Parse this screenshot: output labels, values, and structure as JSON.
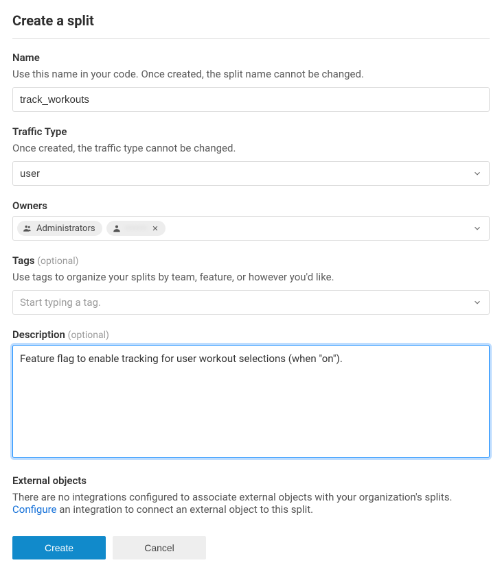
{
  "title": "Create a split",
  "name": {
    "label": "Name",
    "hint": "Use this name in your code. Once created, the split name cannot be changed.",
    "value": "track_workouts"
  },
  "trafficType": {
    "label": "Traffic Type",
    "hint": "Once created, the traffic type cannot be changed.",
    "value": "user"
  },
  "owners": {
    "label": "Owners",
    "chips": [
      {
        "label": "Administrators",
        "icon": "group",
        "removable": false
      },
      {
        "label": "······",
        "icon": "person",
        "removable": true,
        "obscured": true
      }
    ]
  },
  "tags": {
    "label": "Tags",
    "optional": "(optional)",
    "hint": "Use tags to organize your splits by team, feature, or however you'd like.",
    "placeholder": "Start typing a tag."
  },
  "description": {
    "label": "Description",
    "optional": "(optional)",
    "value": "Feature flag to enable tracking for user workout selections (when \"on\")."
  },
  "externalObjects": {
    "label": "External objects",
    "text_before": "There are no integrations configured to associate external objects with your organization's splits. ",
    "link": "Configure",
    "text_after": " an integration to connect an external object to this split."
  },
  "buttons": {
    "create": "Create",
    "cancel": "Cancel"
  }
}
